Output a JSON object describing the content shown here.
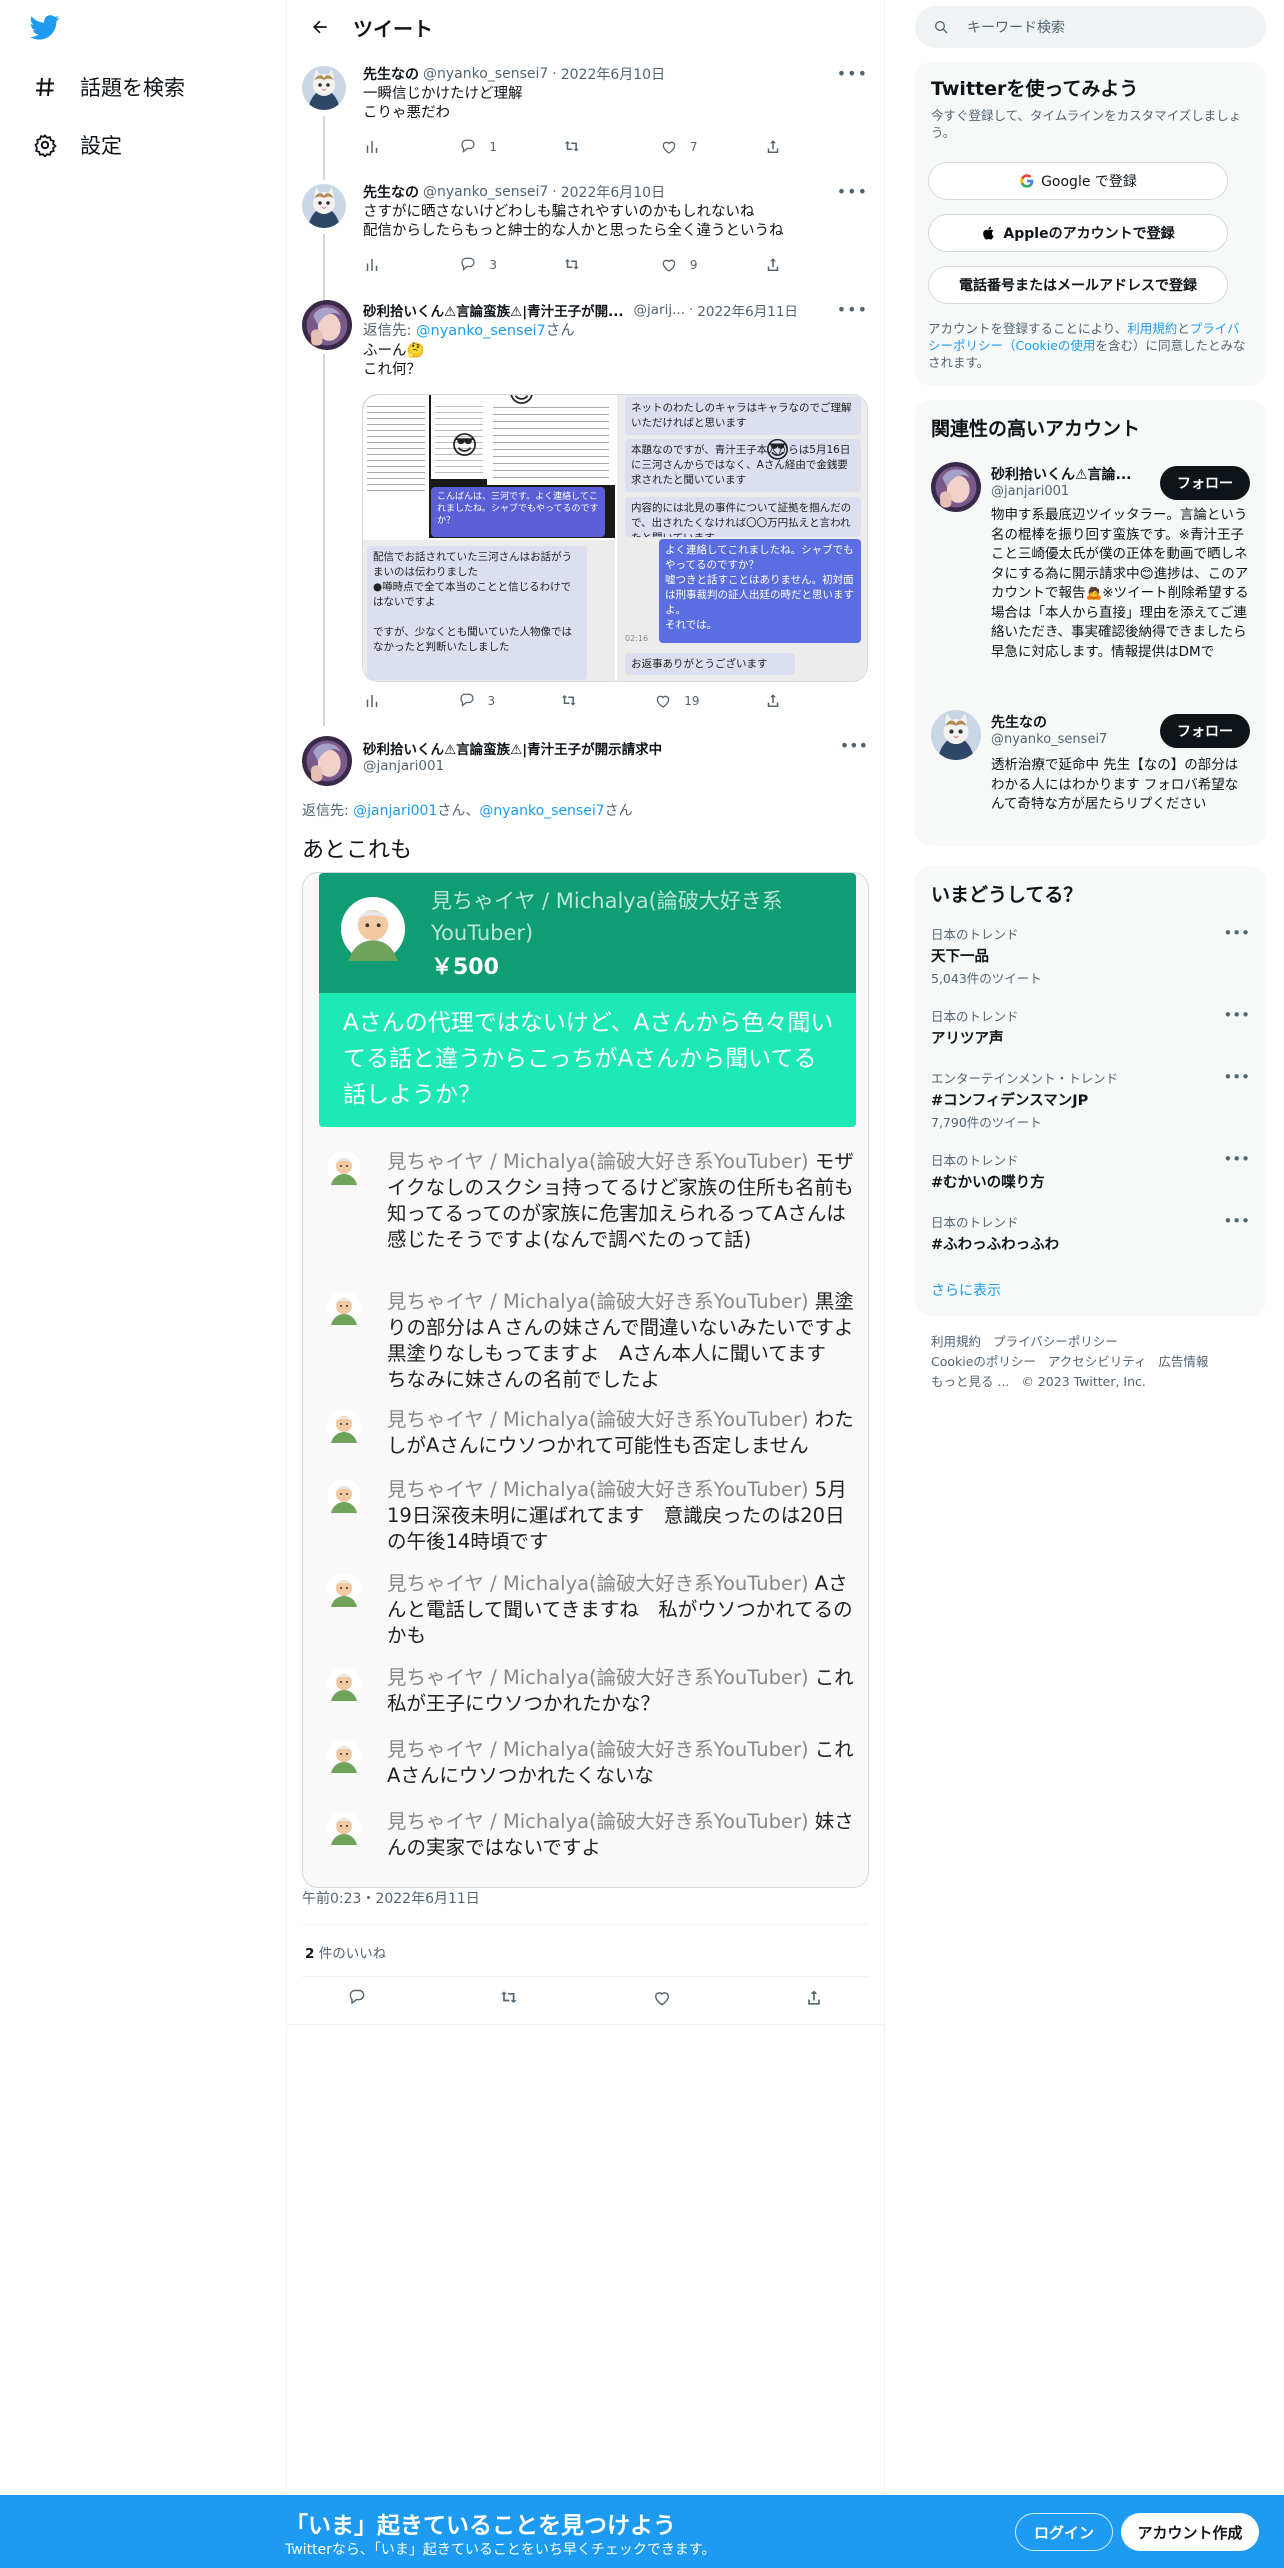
{
  "nav": {
    "explore": "話題を検索",
    "settings": "設定"
  },
  "header": {
    "title": "ツイート"
  },
  "tweets": [
    {
      "name": "先生なの",
      "handle": "@nyanko_sensei7",
      "date": "2022年6月10日",
      "lines": [
        "一瞬信じかけたけど理解",
        "こりゃ悪だわ"
      ],
      "replies": "1",
      "retweets": "",
      "likes": "7"
    },
    {
      "name": "先生なの",
      "handle": "@nyanko_sensei7",
      "date": "2022年6月10日",
      "lines": [
        "さすがに晒さないけどわしも騙されやすいのかもしれないね",
        "配信からしたらもっと紳士的な人かと思ったら全く違うというね"
      ],
      "replies": "3",
      "retweets": "",
      "likes": "9"
    },
    {
      "name": "砂利拾いくん⚠言論蛮族⚠|青汁王子が開...",
      "handle": "@jarij...",
      "date": "2022年6月11日",
      "reply_prefix": "返信先: ",
      "reply_to": "@nyanko_sensei7",
      "reply_suffix": "さん",
      "lines": [
        "ふーん🤔",
        "これ何？"
      ],
      "replies": "3",
      "retweets": "",
      "likes": "19",
      "image_texts": {
        "a_bubble": "こんばんは、三河です。よく連絡してこれましたね。シャブでもやってるのですか？",
        "b_right": "ネットのわたしのキャラはキャラなのでご理解いただければと思います",
        "c_right": "本題なのですが、青汁王子本人からは5月16日に三河さんからではなく、Aさん経由で金銭要求されたと聞いています",
        "d_right": "内容的には北見の事件について証拠を掴んだので、出されたくなければ〇〇万円払えと言われたと聞いています",
        "e_left": "配信でお話されていた三河さんはお話がうまいのは伝わりました\n●噂時点で全て本当のことと信じるわけではないですよ\n\nですが、少なくとも聞いていた人物像ではなかったと判断いたしました",
        "f_bubble": "よく連絡してこれましたね。シャブでもやってるのですか？\n嘘つきと話すことはありません。初対面は刑事裁判の証人出廷の時だと思いますよ。\nそれでは。",
        "g_time": "02:16",
        "h_right": "お返事ありがとうございます"
      }
    }
  ],
  "main_tweet": {
    "name": "砂利拾いくん⚠言論蛮族⚠|青汁王子が開示請求中",
    "handle": "@janjari001",
    "reply_prefix": "返信先: ",
    "reply_to_1": "@janjari001",
    "reply_mid": "さん、",
    "reply_to_2": "@nyanko_sensei7",
    "reply_suffix": "さん",
    "text": "あとこれも",
    "timestamp": "午前0:23・2022年6月11日",
    "likes_count": "2",
    "likes_label": " 件のいいね",
    "superchat": {
      "user": "見ちゃイヤ / Michalya(論破大好き系YouTuber)",
      "amount": "￥500",
      "message": "Aさんの代理ではないけど、Aさんから色々聞いてる話と違うからこっちがAさんから聞いてる話しようか？"
    },
    "chat_lines": [
      {
        "who": "見ちゃイヤ / Michalya(論破大好き系YouTuber)",
        "msg": "モザイクなしのスクショ持ってるけど家族の住所も名前も知ってるってのが家族に危害加えられるってAさんは感じたそうですよ(なんで調べたのって話)"
      },
      {
        "who": "見ちゃイヤ / Michalya(論破大好き系YouTuber)",
        "msg": "黒塗りの部分はＡさんの妹さんで間違いないみたいですよ　黒塗りなしもってますよ　Aさん本人に聞いてます　ちなみに妹さんの名前でしたよ"
      },
      {
        "who": "見ちゃイヤ / Michalya(論破大好き系YouTuber)",
        "msg": "わたしがAさんにウソつかれて可能性も否定しません"
      },
      {
        "who": "見ちゃイヤ / Michalya(論破大好き系YouTuber)",
        "msg": "5月19日深夜未明に運ばれてます　意識戻ったのは20日の午後14時頃です"
      },
      {
        "who": "見ちゃイヤ / Michalya(論破大好き系YouTuber)",
        "msg": "Aさんと電話して聞いてきますね　私がウソつかれてるのかも"
      },
      {
        "who": "見ちゃイヤ / Michalya(論破大好き系YouTuber)",
        "msg": "これ私が王子にウソつかれたかな？"
      },
      {
        "who": "見ちゃイヤ / Michalya(論破大好き系YouTuber)",
        "msg": "これAさんにウソつかれたくないな"
      },
      {
        "who": "見ちゃイヤ / Michalya(論破大好き系YouTuber)",
        "msg": "妹さんの実家ではないですよ"
      }
    ]
  },
  "right": {
    "search_placeholder": "キーワード検索",
    "signup_panel": {
      "title": "Twitterを使ってみよう",
      "subtitle": "今すぐ登録して、タイムラインをカスタマイズしましょう。",
      "google": "Google で登録",
      "apple": "Appleのアカウントで登録",
      "phone": "電話番号またはメールアドレスで登録",
      "terms_1": "アカウントを登録することにより、",
      "terms_link1": "利用規約",
      "terms_2": "と",
      "terms_link2": "プライバシーポリシー（Cookieの使用",
      "terms_3": "を含む）に同意したとみなされます。"
    },
    "related": {
      "title": "関連性の高いアカウント",
      "accounts": [
        {
          "name": "砂利拾いくん⚠言論...",
          "handle": "@janjari001",
          "follow": "フォロー",
          "bio": "物申す系最底辺ツイッタラー。言論という名の棍棒を振り回す蛮族です。※青汁王子こと三崎優太氏が僕の正体を動画で晒しネタにする為に開示請求中😊進捗は、このアカウントで報告🙇※ツイート削除希望する場合は「本人から直接」理由を添えてご連絡いただき、事実確認後納得できましたら早急に対応します。情報提供はDMで"
        },
        {
          "name": "先生なの",
          "handle": "@nyanko_sensei7",
          "follow": "フォロー",
          "bio": "透析治療で延命中 先生【なの】の部分はわかる人にはわかります フォロバ希望なんて奇特な方が居たらリプください"
        }
      ]
    },
    "trends": {
      "title": "いまどうしてる？",
      "items": [
        {
          "cat": "日本のトレンド",
          "name": "天下一品",
          "count": "5,043件のツイート"
        },
        {
          "cat": "日本のトレンド",
          "name": "アリツア声",
          "count": ""
        },
        {
          "cat": "エンターテインメント・トレンド",
          "name": "#コンフィデンスマンJP",
          "count": "7,790件のツイート"
        },
        {
          "cat": "日本のトレンド",
          "name": "#むかいの喋り方",
          "count": ""
        },
        {
          "cat": "日本のトレンド",
          "name": "#ふわっふわっふわ",
          "count": ""
        }
      ],
      "show_more": "さらに表示"
    },
    "footer": {
      "terms": "利用規約",
      "privacy": "プライバシーポリシー",
      "cookie": "Cookieのポリシー",
      "access": "アクセシビリティ",
      "ads": "広告情報",
      "more": "もっと見る ...",
      "copy": "© 2023 Twitter, Inc."
    }
  },
  "bottombar": {
    "title": "「いま」起きていることを見つけよう",
    "subtitle": "Twitterなら、「いま」起きていることをいち早くチェックできます。",
    "login": "ログイン",
    "signup": "アカウント作成"
  },
  "colors": {
    "accent": "#1d9bf0",
    "text": "#0f1419",
    "muted": "#536471",
    "superchat_dark": "#0f9d74",
    "superchat_light": "#1de9b6"
  }
}
